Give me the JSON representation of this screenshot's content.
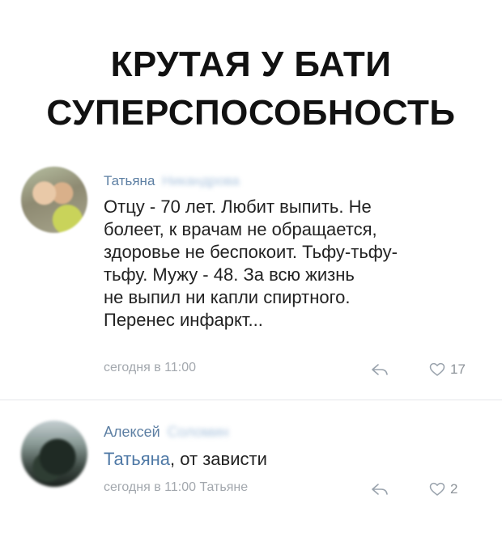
{
  "meme": {
    "title_lines": [
      "КРУТАЯ У БАТИ",
      "СУПЕРСПОСОБНОСТЬ"
    ]
  },
  "comments": [
    {
      "author_first": "Татьяна",
      "author_last": "Никандрова",
      "text_lines": [
        "Отцу - 70 лет. Любит выпить. Не",
        "болеет, к врачам не обращается,",
        "здоровье не беспокоит. Тьфу-тьфу-",
        "тьфу. Мужу - 48. За всю жизнь",
        "не выпил ни капли спиртного.",
        "Перенес инфаркт..."
      ],
      "timestamp": "сегодня в 11:00",
      "likes": "17",
      "avatar_icon": "profile-photo-couple"
    },
    {
      "author_first": "Алексей",
      "author_last": "Соломин",
      "reply_to": "Татьяна",
      "text": ", от зависти",
      "timestamp": "сегодня в 11:00 Татьяне",
      "likes": "2",
      "avatar_icon": "profile-photo-dark"
    }
  ],
  "icons": {
    "reply": "reply-arrow-icon",
    "like": "heart-outline-icon"
  },
  "colors": {
    "author_link": "#5d7fa3",
    "meta_gray": "#a3a8ae",
    "text": "#222222",
    "title": "#111111"
  }
}
